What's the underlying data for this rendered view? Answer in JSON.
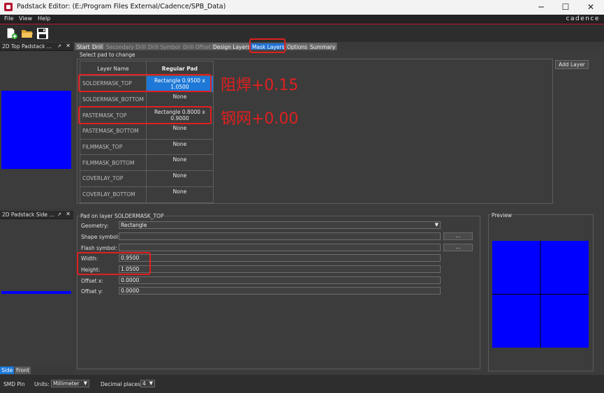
{
  "window": {
    "title": "Padstack Editor:  (E:/Program Files External/Cadence/SPB_Data)",
    "min_glyph": "─",
    "max_glyph": "☐",
    "close_glyph": "✕"
  },
  "menu": {
    "items": [
      "File",
      "View",
      "Help"
    ],
    "brand": "cadence"
  },
  "toolbar": {
    "icons": [
      "new-file-icon",
      "open-folder-icon",
      "save-icon"
    ]
  },
  "left_panels": {
    "top": {
      "title": "2D Top Padstack ...",
      "pin": "⇗",
      "close": "✕"
    },
    "side": {
      "title": "2D Padstack Side ...",
      "pin": "⇗",
      "close": "✕"
    },
    "view_tabs": [
      "Side",
      "Front"
    ]
  },
  "tabs": [
    {
      "label": "Start",
      "state": "normal"
    },
    {
      "label": "Drill",
      "state": "normal"
    },
    {
      "label": "Secondary Drill",
      "state": "disabled"
    },
    {
      "label": "Drill Symbol",
      "state": "disabled"
    },
    {
      "label": "Drill Offset",
      "state": "disabled"
    },
    {
      "label": "Design Layers",
      "state": "normal"
    },
    {
      "label": "Mask Layers",
      "state": "active"
    },
    {
      "label": "Options",
      "state": "normal"
    },
    {
      "label": "Summary",
      "state": "normal"
    }
  ],
  "pad_select": {
    "caption": "Select pad to change",
    "columns": [
      "Layer Name",
      "Regular Pad"
    ],
    "rows": [
      {
        "layer": "SOLDERMASK_TOP",
        "pad": "Rectangle 0.9500 x 1.0500"
      },
      {
        "layer": "SOLDERMASK_BOTTOM",
        "pad": "None"
      },
      {
        "layer": "PASTEMASK_TOP",
        "pad": "Rectangle 0.8000 x 0.9000"
      },
      {
        "layer": "PASTEMASK_BOTTOM",
        "pad": "None"
      },
      {
        "layer": "FILMMASK_TOP",
        "pad": "None"
      },
      {
        "layer": "FILMMASK_BOTTOM",
        "pad": "None"
      },
      {
        "layer": "COVERLAY_TOP",
        "pad": "None"
      },
      {
        "layer": "COVERLAY_BOTTOM",
        "pad": "None"
      }
    ],
    "add_layer": "Add Layer"
  },
  "pad_props": {
    "caption": "Pad on layer SOLDERMASK_TOP",
    "geometry_label": "Geometry:",
    "geometry_value": "Rectangle",
    "shape_symbol_label": "Shape symbol:",
    "shape_symbol_value": "",
    "flash_symbol_label": "Flash symbol:",
    "flash_symbol_value": "",
    "browse": "...",
    "width_label": "Width:",
    "width_value": "0.9500",
    "height_label": "Height:",
    "height_value": "1.0500",
    "offset_x_label": "Offset x:",
    "offset_x_value": "0.0000",
    "offset_y_label": "Offset y:",
    "offset_y_value": "0.0000"
  },
  "preview": {
    "caption": "Preview"
  },
  "annotations": {
    "soldermask": "阻焊+0.15",
    "stencil": "钢网+0.00",
    "color": "#e02020"
  },
  "status": {
    "mode": "SMD Pin",
    "units_label": "Units:",
    "units_value": "Millimeter",
    "decimal_label": "Decimal places:",
    "decimal_value": "4"
  },
  "colors": {
    "accent": "#1e78d7",
    "pad_fill": "#0000ff",
    "annotation": "#e02020"
  }
}
